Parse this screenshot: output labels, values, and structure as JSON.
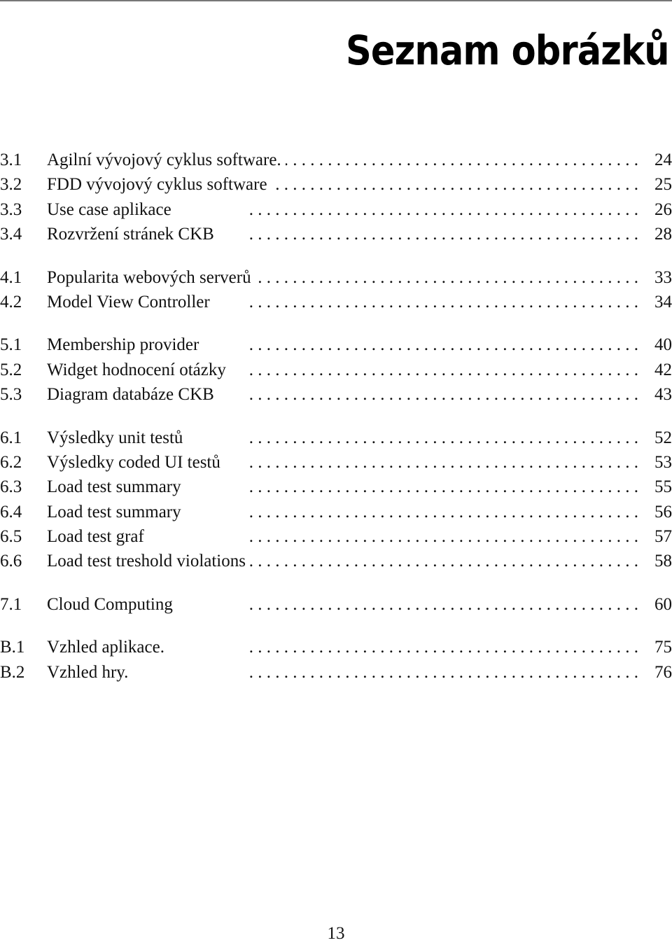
{
  "heading": "Seznam obrázků",
  "groups": [
    {
      "entries": [
        {
          "num": "3.1",
          "title": "Agilní vývojový cyklus software.",
          "page": "24"
        },
        {
          "num": "3.2",
          "title": "FDD vývojový cyklus software",
          "page": "25"
        },
        {
          "num": "3.3",
          "title": "Use case aplikace",
          "page": "26"
        },
        {
          "num": "3.4",
          "title": "Rozvržení stránek CKB",
          "page": "28"
        }
      ]
    },
    {
      "entries": [
        {
          "num": "4.1",
          "title": "Popularita webových serverů",
          "page": "33"
        },
        {
          "num": "4.2",
          "title": "Model View Controller",
          "page": "34"
        }
      ]
    },
    {
      "entries": [
        {
          "num": "5.1",
          "title": "Membership provider",
          "page": "40"
        },
        {
          "num": "5.2",
          "title": "Widget hodnocení otázky",
          "page": "42"
        },
        {
          "num": "5.3",
          "title": "Diagram databáze CKB",
          "page": "43"
        }
      ]
    },
    {
      "entries": [
        {
          "num": "6.1",
          "title": "Výsledky unit testů",
          "page": "52"
        },
        {
          "num": "6.2",
          "title": "Výsledky coded UI testů",
          "page": "53"
        },
        {
          "num": "6.3",
          "title": "Load test summary",
          "page": "55"
        },
        {
          "num": "6.4",
          "title": "Load test summary",
          "page": "56"
        },
        {
          "num": "6.5",
          "title": "Load test graf",
          "page": "57"
        },
        {
          "num": "6.6",
          "title": "Load test treshold violations",
          "page": "58"
        }
      ]
    },
    {
      "entries": [
        {
          "num": "7.1",
          "title": "Cloud Computing",
          "page": "60"
        }
      ]
    },
    {
      "entries": [
        {
          "num": "B.1",
          "title": "Vzhled aplikace.",
          "page": "75"
        },
        {
          "num": "B.2",
          "title": "Vzhled hry.",
          "page": "76"
        }
      ]
    }
  ],
  "leader": " . . . . . . . . . . . . . . . . . . . . . . . . . . . . . . . . . . . . . . . . . . . . .",
  "page_number": "13"
}
